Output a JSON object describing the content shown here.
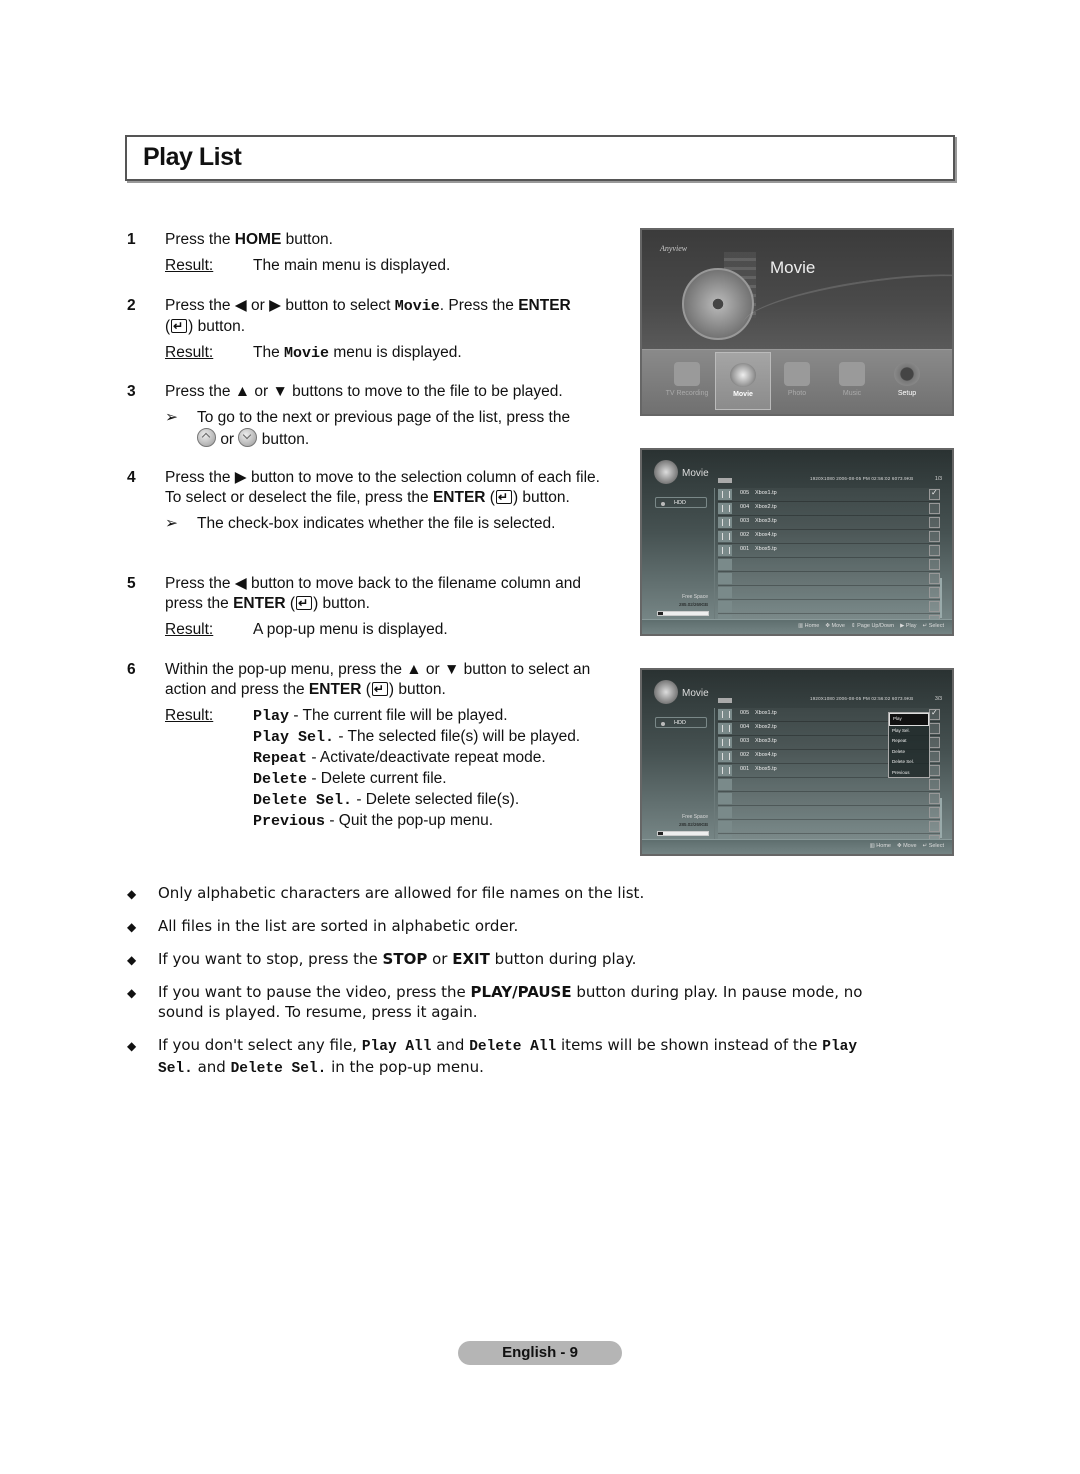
{
  "page": {
    "title": "Play List",
    "footer": "English - 9"
  },
  "labels": {
    "result": "Result:",
    "or": "or",
    "button": "button."
  },
  "steps": [
    {
      "num": "1",
      "parts": [
        "Press the ",
        "HOME",
        " button."
      ],
      "result": "The main menu is displayed."
    },
    {
      "num": "2",
      "parts": [
        "Press the ◀ or ▶ button to select ",
        "Movie",
        ". Press the ",
        "ENTER",
        " (",
        ") button."
      ],
      "result_parts": [
        "The ",
        "Movie",
        " menu is displayed."
      ]
    },
    {
      "num": "3",
      "text": "Press the ▲ or ▼ buttons to move to the file to be played.",
      "note": "To go to the next or previous page of the list, press the"
    },
    {
      "num": "4",
      "parts": [
        "Press the ▶ button to move to the selection column of each file. To select or deselect the file, press the ",
        "ENTER",
        " (",
        ") button."
      ],
      "note": "The check-box indicates whether the file is selected."
    },
    {
      "num": "5",
      "parts": [
        "Press the ◀ button to move back to the filename column and press the ",
        "ENTER",
        " (",
        ") button."
      ],
      "result": "A pop-up menu is displayed."
    },
    {
      "num": "6",
      "parts": [
        "Within the pop-up menu, press the ▲ or ▼ button to select an action and press the ",
        "ENTER",
        " (",
        ") button."
      ],
      "results": [
        {
          "cmd": "Play",
          "desc": " - The current file will be played."
        },
        {
          "cmd": "Play Sel.",
          "desc": " - The selected file(s) will be played."
        },
        {
          "cmd": "Repeat",
          "desc": " - Activate/deactivate repeat mode."
        },
        {
          "cmd": "Delete",
          "desc": " - Delete current file."
        },
        {
          "cmd": "Delete Sel.",
          "desc": " - Delete selected file(s)."
        },
        {
          "cmd": "Previous",
          "desc": " - Quit the pop-up menu."
        }
      ]
    }
  ],
  "screen_main_menu": {
    "logo": "Anyview",
    "title": "Movie",
    "menu_items": [
      {
        "label": "TV Recording",
        "icon": "tv-recording-icon",
        "selected": false
      },
      {
        "label": "Movie",
        "icon": "movie-reel-icon",
        "selected": true
      },
      {
        "label": "Photo",
        "icon": "photo-icon",
        "selected": false
      },
      {
        "label": "Music",
        "icon": "headphones-icon",
        "selected": false
      },
      {
        "label": "Setup",
        "icon": "gear-icon",
        "selected": false
      }
    ]
  },
  "screen_movie_list": {
    "title": "Movie",
    "status": "1920X1080  2006-08-05 PM 02:56:02  6073.9KB",
    "page": "1/3",
    "device": "HDD",
    "free_space_label": "Free Space",
    "free_space_value": "285.02/269GB",
    "free_space_used_fraction": 0.1,
    "files": [
      {
        "no": "005",
        "name": "Xbox1.tp",
        "checked": true
      },
      {
        "no": "004",
        "name": "Xbox2.tp",
        "checked": false
      },
      {
        "no": "003",
        "name": "Xbox3.tp",
        "checked": false
      },
      {
        "no": "002",
        "name": "Xbox4.tp",
        "checked": false
      },
      {
        "no": "001",
        "name": "Xbox5.tp",
        "checked": false
      }
    ],
    "hints": [
      "Home",
      "Move",
      "Page Up/Down",
      "Play",
      "Select"
    ]
  },
  "screen_popup": {
    "title": "Movie",
    "status": "1920X1080  2006-08-05 PM 02:56:02  6073.9KB",
    "page": "3/3",
    "device": "HDD",
    "free_space_label": "Free Space",
    "free_space_value": "285.02/269GB",
    "free_space_used_fraction": 0.1,
    "files": [
      {
        "no": "005",
        "name": "Xbox1.tp",
        "checked": true
      },
      {
        "no": "004",
        "name": "Xbox2.tp",
        "checked": false
      },
      {
        "no": "003",
        "name": "Xbox3.tp",
        "checked": false
      },
      {
        "no": "002",
        "name": "Xbox4.tp",
        "checked": false
      },
      {
        "no": "001",
        "name": "Xbox5.tp",
        "checked": false
      }
    ],
    "popup_items": [
      "Play",
      "Play Sel.",
      "Repeat",
      "Delete",
      "Delete Sel.",
      "Previous"
    ],
    "popup_selected": "Play",
    "hints": [
      "Home",
      "Move",
      "Select"
    ]
  },
  "bullets": [
    {
      "parts": [
        {
          "t": "Only alphabetic characters are allowed for file names on the list."
        }
      ]
    },
    {
      "parts": [
        {
          "t": "All files in the list are sorted in alphabetic order."
        }
      ]
    },
    {
      "parts": [
        {
          "t": "If you want to stop, press the "
        },
        {
          "t": "STOP",
          "b": true
        },
        {
          "t": " or "
        },
        {
          "t": "EXIT",
          "b": true
        },
        {
          "t": " button during play."
        }
      ]
    },
    {
      "parts": [
        {
          "t": "If you want to pause the video, press the "
        },
        {
          "t": "PLAY/PAUSE",
          "b": true
        },
        {
          "t": " button during play. In pause mode, no sound is played. To resume, press it again."
        }
      ]
    },
    {
      "parts": [
        {
          "t": "If you don't select any file, "
        },
        {
          "t": "Play All",
          "m": true
        },
        {
          "t": " and "
        },
        {
          "t": "Delete All",
          "m": true
        },
        {
          "t": " items will be shown instead of the "
        },
        {
          "t": "Play Sel.",
          "m": true
        },
        {
          "t": " and "
        },
        {
          "t": "Delete Sel.",
          "m": true
        },
        {
          "t": " in the pop-up menu."
        }
      ]
    }
  ]
}
